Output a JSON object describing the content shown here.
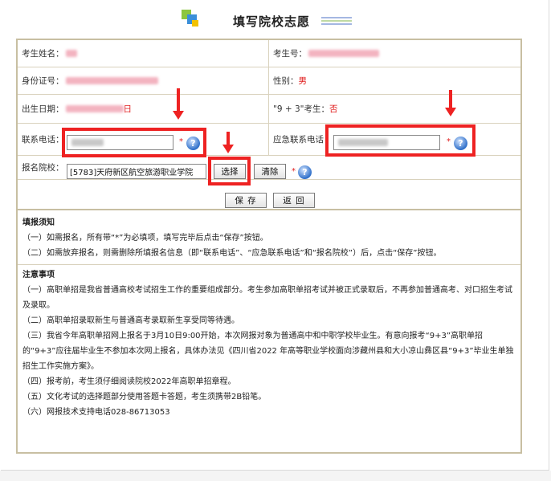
{
  "page": {
    "title": "填写院校志愿"
  },
  "form": {
    "name_label": "考生姓名：",
    "exam_no_label": "考生号：",
    "id_label": "身份证号：",
    "gender_label": "性别：",
    "gender_value": "男",
    "birth_label": "出生日期：",
    "birth_value": "日",
    "nine_three_label": "\"9 + 3\"考生：",
    "nine_three_value": "否",
    "phone_label": "联系电话：",
    "emergency_phone_label": "应急联系电话",
    "school_label": "报名院校：",
    "school_value": "[5783]天府新区航空旅游职业学院",
    "required_mark": "*",
    "help_glyph": "?",
    "select_button": "选择",
    "clear_button": "清除",
    "save_button": "保 存",
    "back_button": "返 回"
  },
  "notice": {
    "fill_heading": "填报须知",
    "fill_items": [
      "（一）如需报名，所有带“*”为必填项，填写完毕后点击“保存”按钮。",
      "（二）如需放弃报名，则需删除所填报名信息（即“联系电话”、“应急联系电话”和“报名院校”）后，点击“保存”按钮。"
    ],
    "attention_heading": "注意事项",
    "attention_items": [
      "（一）高职单招是我省普通高校考试招生工作的重要组成部分。考生参加高职单招考试并被正式录取后，不再参加普通高考、对口招生考试及录取。",
      "（二）高职单招录取新生与普通高考录取新生享受同等待遇。",
      "（三）我省今年高职单招网上报名于3月10日9:00开始，本次网报对象为普通高中和中职学校毕业生。有意向报考“9+3”高职单招的“9+3”应往届毕业生不参加本次网上报名，具体办法见《四川省2022 年高等职业学校面向涉藏州县和大小凉山彝区县“9+3”毕业生单独招生工作实施方案》。",
      "（四）报考前，考生须仔细阅读院校2022年高职单招章程。",
      "（五）文化考试的选择题部分使用答题卡答题，考生须携带2B铅笔。",
      "（六）网报技术支持电话028-86713053"
    ]
  },
  "colors": {
    "highlight": "#ee2222",
    "required": "#e01c1c",
    "border": "#c8bfa2"
  }
}
